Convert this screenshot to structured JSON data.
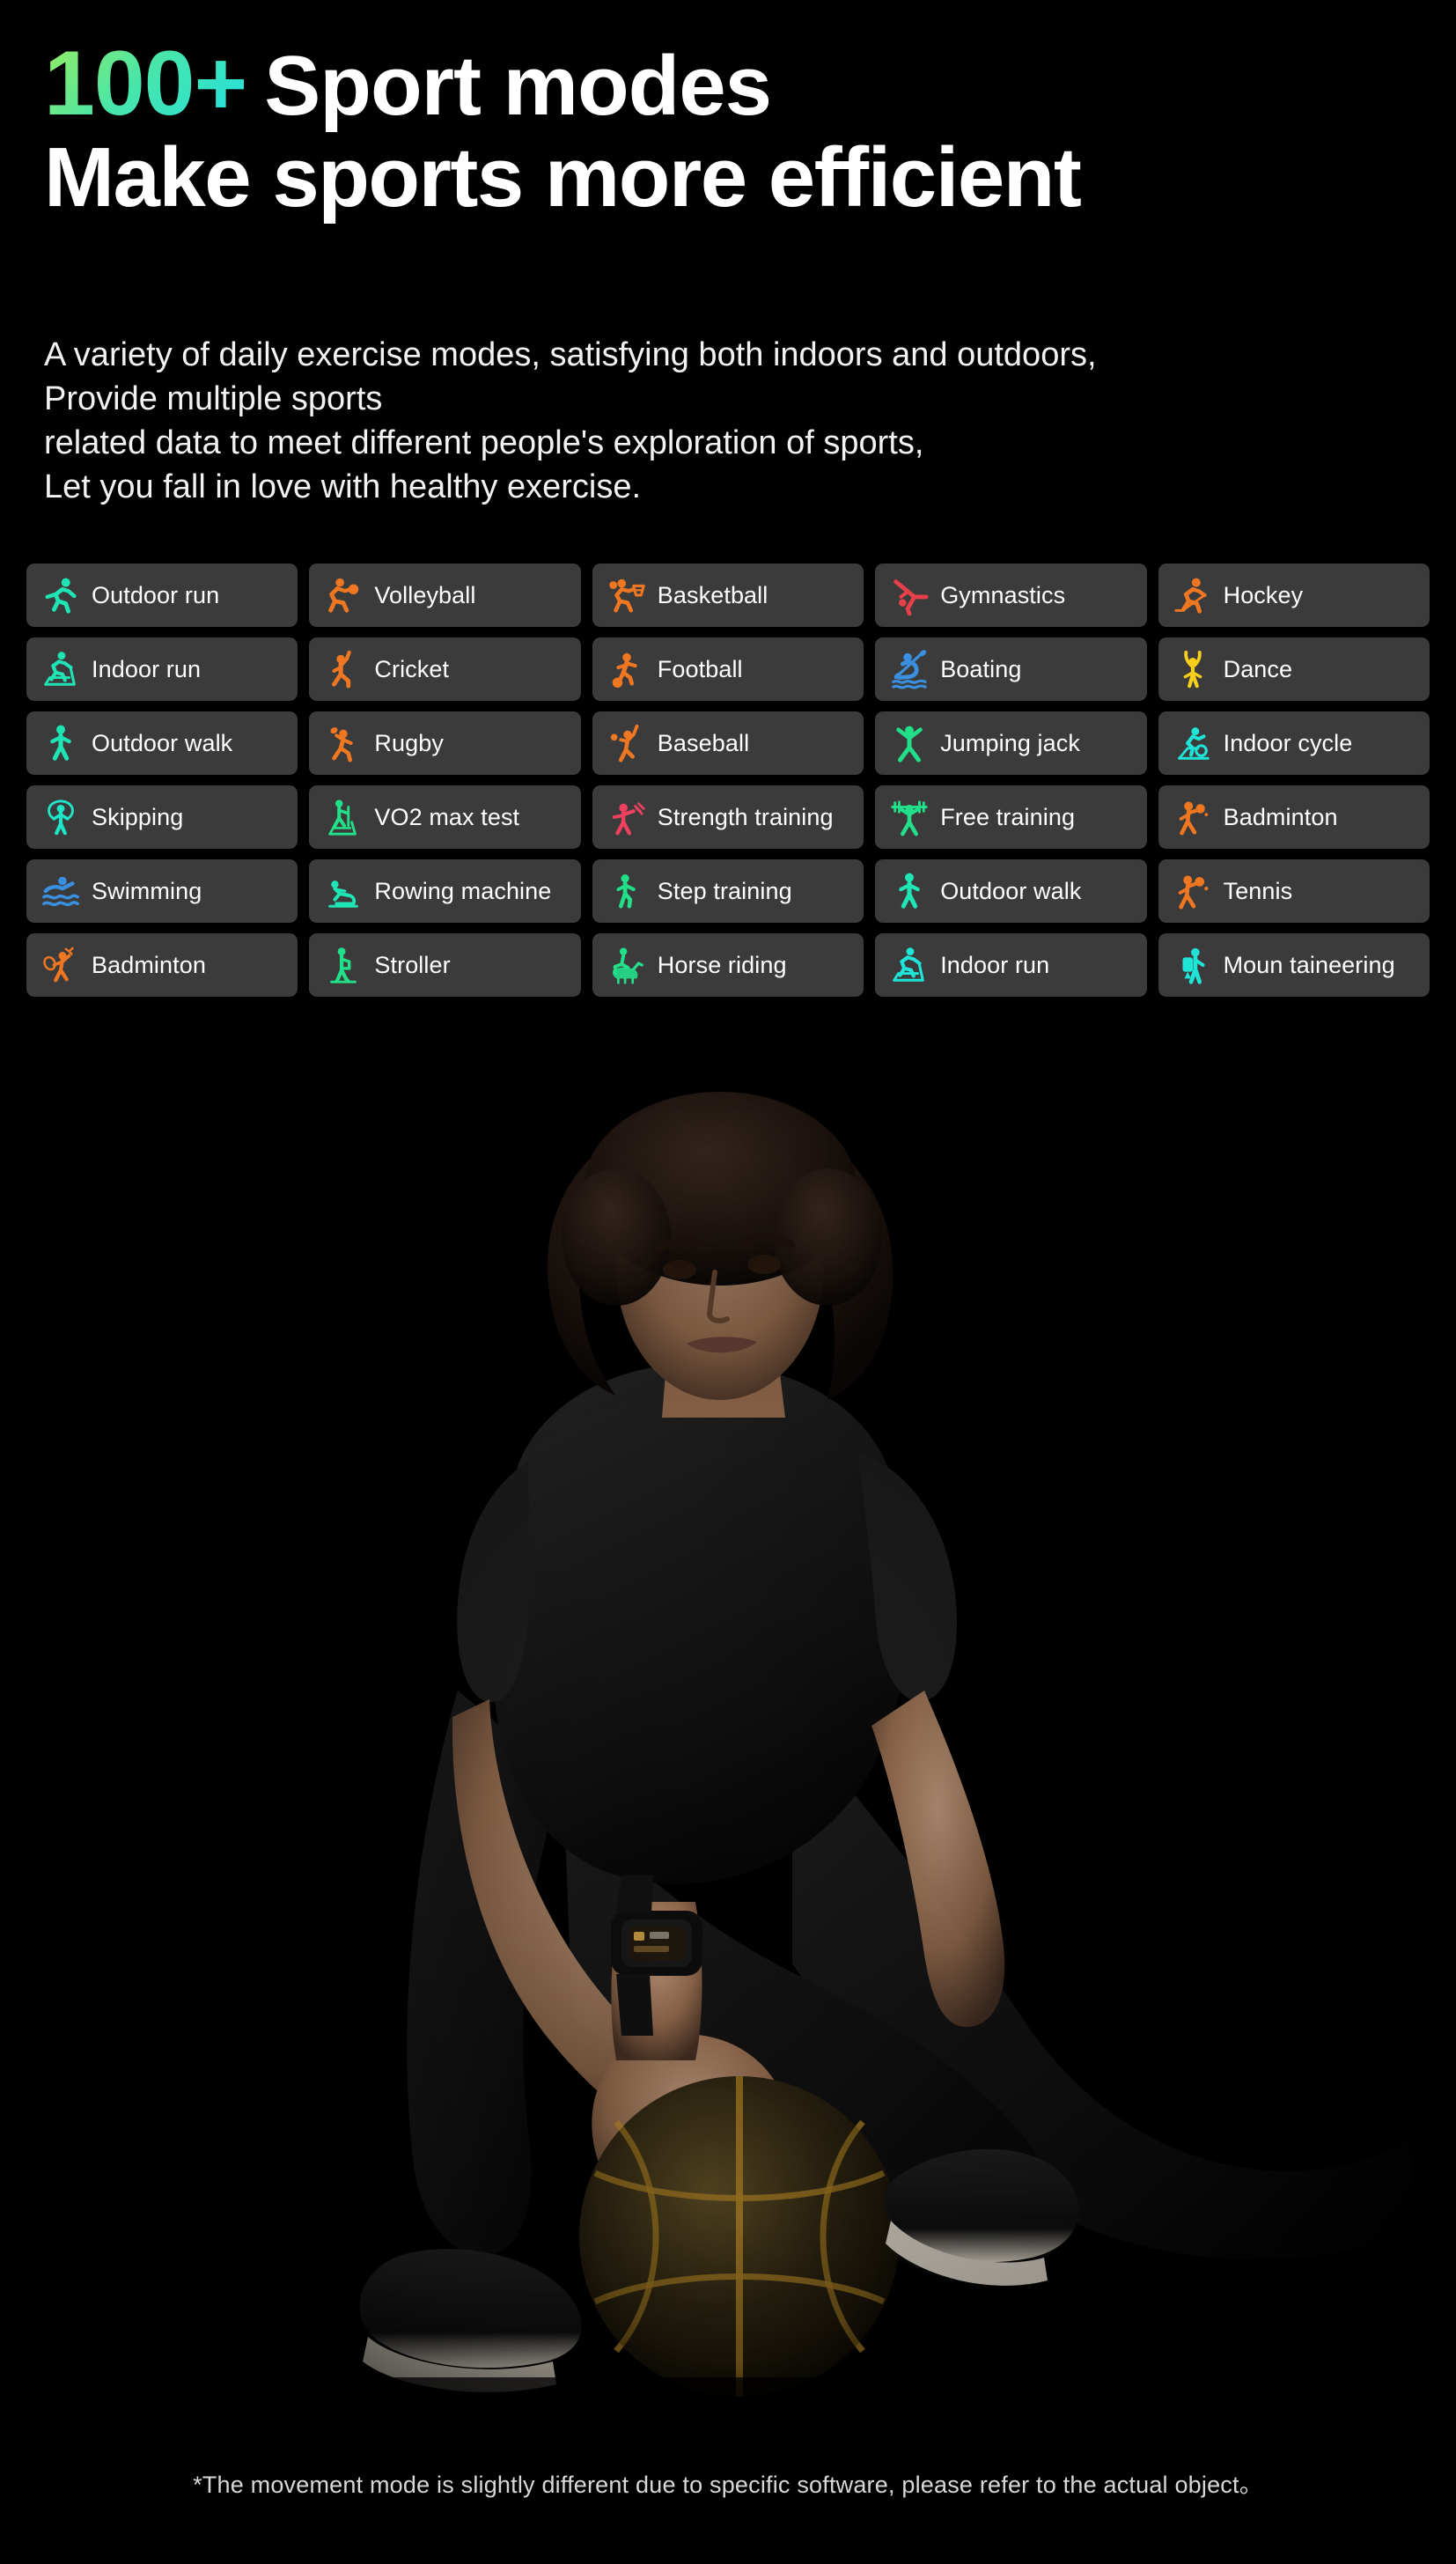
{
  "headline": {
    "number": "100+",
    "line1_main": "Sport modes",
    "line2": "Make sports more efficient",
    "gradient_start": "#9ced5c",
    "gradient_end": "#1fdfe4"
  },
  "description": {
    "line1": "A variety of daily exercise modes, satisfying both indoors and outdoors,",
    "line2": "Provide multiple sports",
    "line3": "related data to meet different people's exploration of sports,",
    "line4": "Let you fall in love with healthy exercise."
  },
  "sport_grid": {
    "card_bg": "#3b3b3b",
    "columns": 5,
    "rows": 6,
    "items": [
      {
        "label": "Outdoor run",
        "icon": "outdoor-run-icon",
        "color": "#1fe5b4"
      },
      {
        "label": "Volleyball",
        "icon": "volleyball-icon",
        "color": "#ef7722"
      },
      {
        "label": "Basketball",
        "icon": "basketball-icon",
        "color": "#ef7722"
      },
      {
        "label": "Gymnastics",
        "icon": "gymnastics-icon",
        "color": "#e8404a"
      },
      {
        "label": "Hockey",
        "icon": "hockey-icon",
        "color": "#ef7722"
      },
      {
        "label": "Indoor run",
        "icon": "indoor-run-icon",
        "color": "#1fe5b4"
      },
      {
        "label": "Cricket",
        "icon": "cricket-icon",
        "color": "#ef7722"
      },
      {
        "label": "Football",
        "icon": "football-icon",
        "color": "#ef7722"
      },
      {
        "label": "Boating",
        "icon": "boating-icon",
        "color": "#3b8fe0"
      },
      {
        "label": "Dance",
        "icon": "dance-icon",
        "color": "#f5cf1b"
      },
      {
        "label": "Outdoor walk",
        "icon": "outdoor-walk-icon",
        "color": "#1fe5b4"
      },
      {
        "label": "Rugby",
        "icon": "rugby-icon",
        "color": "#ef7722"
      },
      {
        "label": "Baseball",
        "icon": "baseball-icon",
        "color": "#ef7722"
      },
      {
        "label": "Jumping jack",
        "icon": "jumping-jack-icon",
        "color": "#22e08a"
      },
      {
        "label": "Indoor cycle",
        "icon": "indoor-cycle-icon",
        "color": "#1fe5d8"
      },
      {
        "label": "Skipping",
        "icon": "skipping-icon",
        "color": "#1fe5c8"
      },
      {
        "label": "VO2 max test",
        "icon": "vo2-max-test-icon",
        "color": "#22e08a"
      },
      {
        "label": "Strength training",
        "icon": "strength-training-icon",
        "color": "#ef4060"
      },
      {
        "label": "Free training",
        "icon": "free-training-icon",
        "color": "#22e08a"
      },
      {
        "label": "Badminton",
        "icon": "badminton-icon",
        "color": "#ef7722"
      },
      {
        "label": "Swimming",
        "icon": "swimming-icon",
        "color": "#3b8fe0"
      },
      {
        "label": "Rowing machine",
        "icon": "rowing-machine-icon",
        "color": "#1fe5b4"
      },
      {
        "label": "Step training",
        "icon": "step-training-icon",
        "color": "#22e08a"
      },
      {
        "label": "Outdoor walk",
        "icon": "outdoor-walk-icon",
        "color": "#1fe5b4"
      },
      {
        "label": "Tennis",
        "icon": "tennis-icon",
        "color": "#ef7722"
      },
      {
        "label": "Badminton",
        "icon": "badminton-racket-icon",
        "color": "#ef7722"
      },
      {
        "label": "Stroller",
        "icon": "stroller-icon",
        "color": "#22e08a"
      },
      {
        "label": "Horse riding",
        "icon": "horse-riding-icon",
        "color": "#22e08a"
      },
      {
        "label": "Indoor run",
        "icon": "indoor-run-icon",
        "color": "#1fe5d8"
      },
      {
        "label": "Moun taineering",
        "icon": "mountaineering-icon",
        "color": "#1fe5d8"
      }
    ]
  },
  "more_indicator": {
    "dot_count": 6
  },
  "photo": {
    "description": "Male model with afro hair crouching, wearing black t-shirt and black leggings, black smartwatch on left wrist, hand resting on a dark basketball with gold seams",
    "background": "#000000"
  },
  "footer": {
    "disclaimer": "*The movement mode is slightly different due to specific software, please refer to the actual object。"
  }
}
